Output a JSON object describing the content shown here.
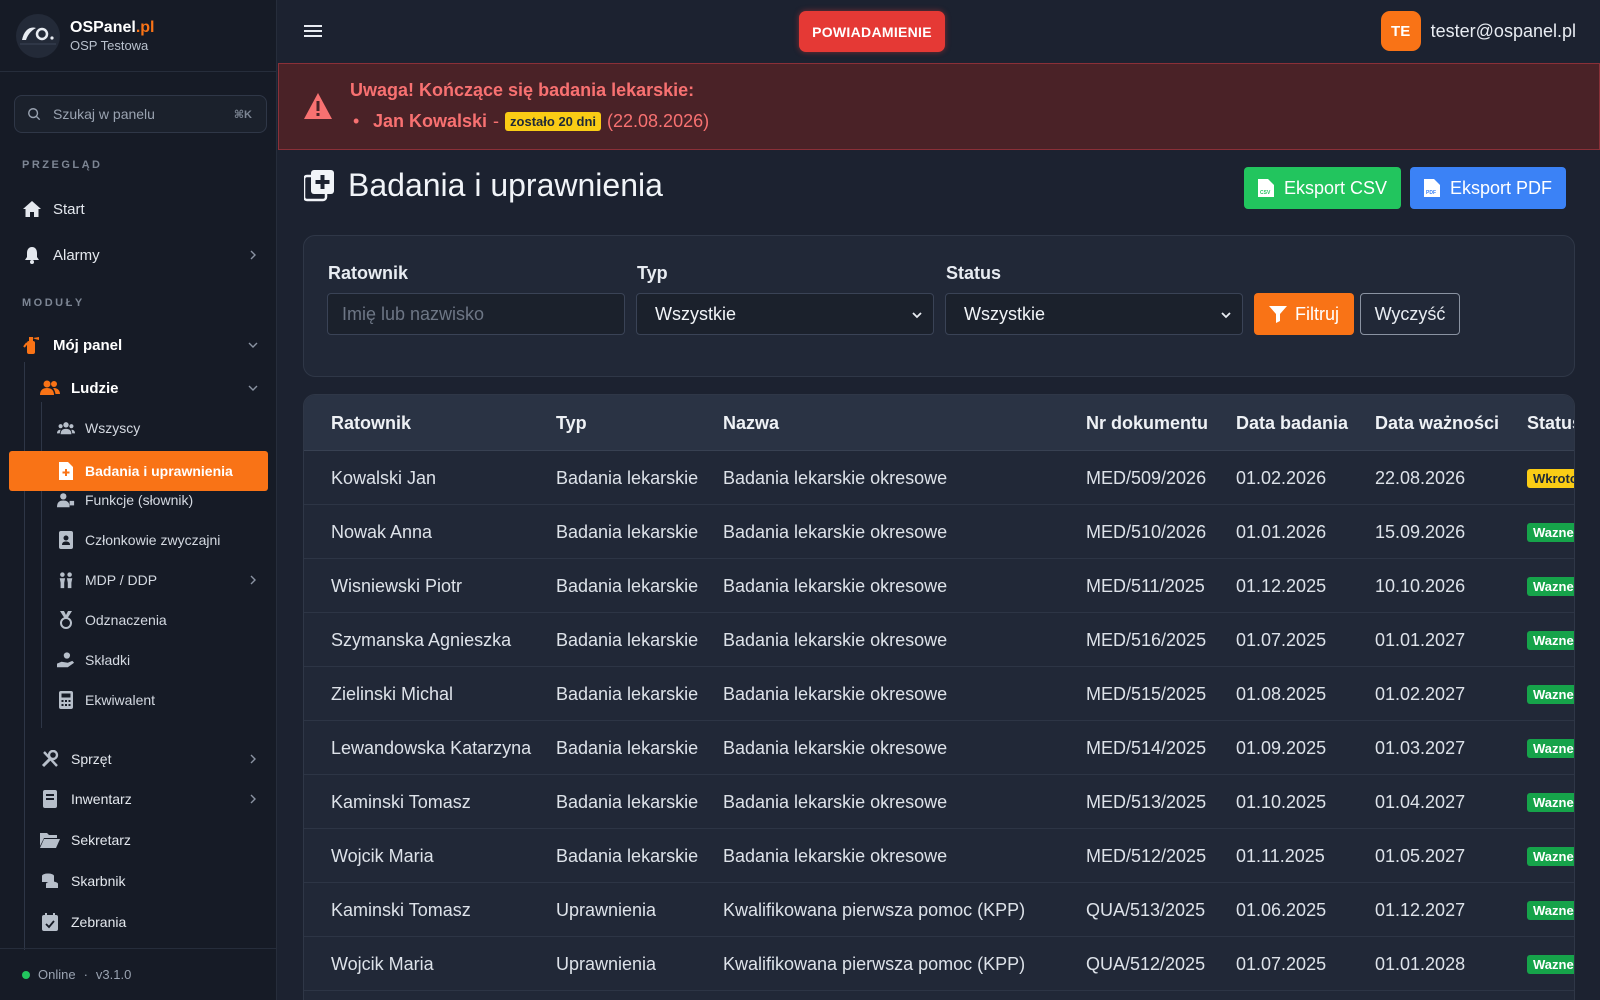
{
  "brand": {
    "name": "OSPanel",
    "tld": ".pl",
    "subtitle": "OSP Testowa"
  },
  "search": {
    "placeholder": "Szukaj w panelu",
    "shortcut": "⌘K"
  },
  "sidebar": {
    "section_overview": "PRZEGLĄD",
    "section_modules": "MODUŁY",
    "start": "Start",
    "alarms": "Alarmy",
    "my_panel": "Mój panel",
    "people": "Ludzie",
    "people_items": [
      "Wszyscy",
      "Badania i uprawnienia",
      "Funkcje (słownik)",
      "Członkowie zwyczajni",
      "MDP / DDP",
      "Odznaczenia",
      "Składki",
      "Ekwiwalent"
    ],
    "modules": [
      "Sprzęt",
      "Inwentarz",
      "Sekretarz",
      "Skarbnik",
      "Zebrania"
    ],
    "footer_status": "Online",
    "footer_sep": "·",
    "footer_version": "v3.1.0"
  },
  "topbar": {
    "notify_label": "POWIADAMIENIE",
    "avatar_initials": "TE",
    "user_email": "tester@ospanel.pl"
  },
  "alert": {
    "title": "Uwaga! Kończące się badania lekarskie:",
    "bullet": "•",
    "item_name": "Jan Kowalski",
    "item_dash": "-",
    "item_badge": "zostało 20 dni",
    "item_date": "(22.08.2026)"
  },
  "page": {
    "title": "Badania i uprawnienia",
    "export_csv": "Eksport CSV",
    "export_pdf": "Eksport PDF"
  },
  "filters": {
    "ratownik_label": "Ratownik",
    "ratownik_placeholder": "Imię lub nazwisko",
    "typ_label": "Typ",
    "typ_value": "Wszystkie",
    "status_label": "Status",
    "status_value": "Wszystkie",
    "filter_button": "Filtruj",
    "clear_button": "Wyczyść"
  },
  "table": {
    "headers": [
      "Ratownik",
      "Typ",
      "Nazwa",
      "Nr dokumentu",
      "Data badania",
      "Data ważności",
      "Status"
    ],
    "rows": [
      [
        "Kowalski Jan",
        "Badania lekarskie",
        "Badania lekarskie okresowe",
        "MED/509/2026",
        "01.02.2026",
        "22.08.2026",
        "Wkrotce"
      ],
      [
        "Nowak Anna",
        "Badania lekarskie",
        "Badania lekarskie okresowe",
        "MED/510/2026",
        "01.01.2026",
        "15.09.2026",
        "Wazne"
      ],
      [
        "Wisniewski Piotr",
        "Badania lekarskie",
        "Badania lekarskie okresowe",
        "MED/511/2025",
        "01.12.2025",
        "10.10.2026",
        "Wazne"
      ],
      [
        "Szymanska Agnieszka",
        "Badania lekarskie",
        "Badania lekarskie okresowe",
        "MED/516/2025",
        "01.07.2025",
        "01.01.2027",
        "Wazne"
      ],
      [
        "Zielinski Michal",
        "Badania lekarskie",
        "Badania lekarskie okresowe",
        "MED/515/2025",
        "01.08.2025",
        "01.02.2027",
        "Wazne"
      ],
      [
        "Lewandowska Katarzyna",
        "Badania lekarskie",
        "Badania lekarskie okresowe",
        "MED/514/2025",
        "01.09.2025",
        "01.03.2027",
        "Wazne"
      ],
      [
        "Kaminski Tomasz",
        "Badania lekarskie",
        "Badania lekarskie okresowe",
        "MED/513/2025",
        "01.10.2025",
        "01.04.2027",
        "Wazne"
      ],
      [
        "Wojcik Maria",
        "Badania lekarskie",
        "Badania lekarskie okresowe",
        "MED/512/2025",
        "01.11.2025",
        "01.05.2027",
        "Wazne"
      ],
      [
        "Kaminski Tomasz",
        "Uprawnienia",
        "Kwalifikowana pierwsza pomoc (KPP)",
        "QUA/513/2025",
        "01.06.2025",
        "01.12.2027",
        "Wazne"
      ],
      [
        "Wojcik Maria",
        "Uprawnienia",
        "Kwalifikowana pierwsza pomoc (KPP)",
        "QUA/512/2025",
        "01.07.2025",
        "01.01.2028",
        "Wazne"
      ]
    ],
    "status_warn": "Wkrotce"
  },
  "colors": {
    "accent": "#f97316",
    "danger": "#e53935",
    "success": "#22c55e",
    "primary": "#3b82f6",
    "warning": "#facc15"
  }
}
